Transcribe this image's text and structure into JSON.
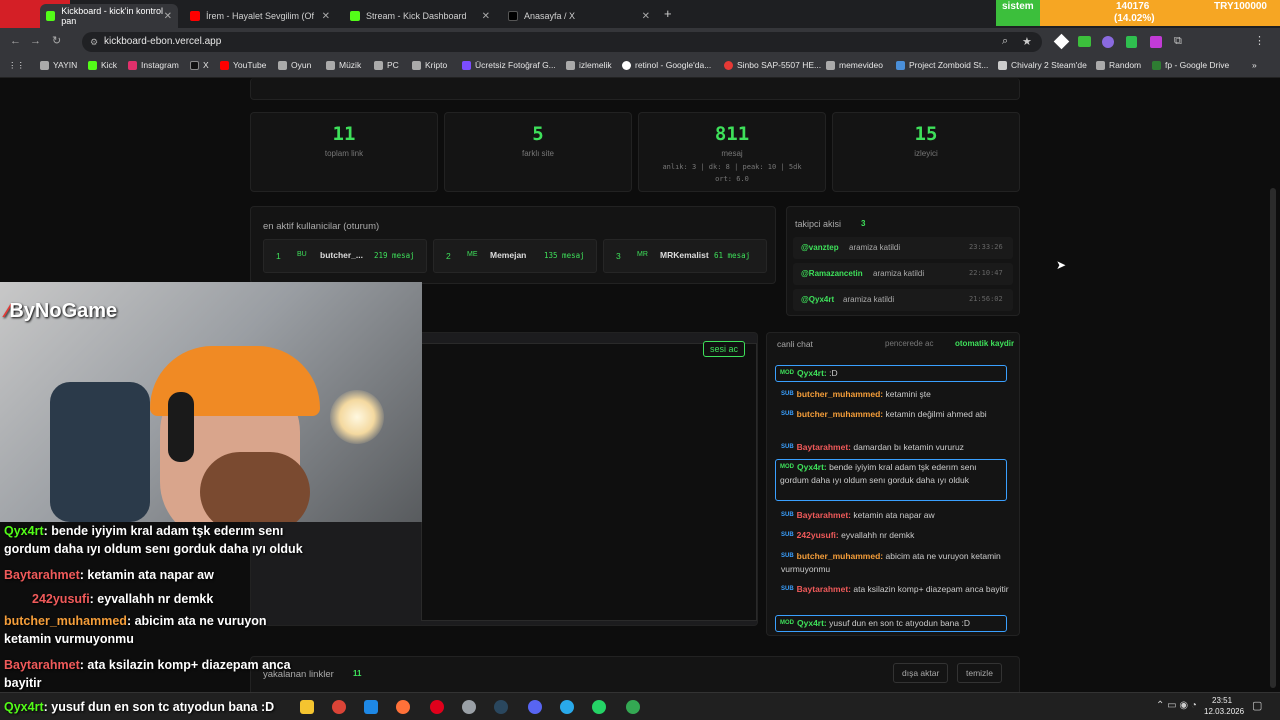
{
  "browser": {
    "tabs": [
      {
        "title": "Kickboard - kick'in kontrol pan"
      },
      {
        "title": "İrem - Hayalet Sevgilim (Of"
      },
      {
        "title": "Stream - Kick Dashboard"
      },
      {
        "title": "Anasayfa / X"
      }
    ],
    "url": "kickboard-ebon.vercel.app",
    "bookmarks": [
      "YAYIN",
      "Kick",
      "Instagram",
      "X",
      "YouTube",
      "Oyun",
      "Müzik",
      "PC",
      "Kripto",
      "Ücretsiz Fotoğraf G...",
      "izlemelik",
      "retinol - Google'da...",
      "Sinbo SAP-5507 HE...",
      "memevideo",
      "Project Zomboid St...",
      "Chivalry 2 Steam'de",
      "Random",
      "fp - Google Drive"
    ]
  },
  "ticker": {
    "label": "sistem",
    "value": "140176",
    "change": "(14.02%)",
    "pair": "TRY100000"
  },
  "stats": [
    {
      "value": "11",
      "label": "toplam link"
    },
    {
      "value": "5",
      "label": "farklı site"
    },
    {
      "value": "811",
      "label": "mesaj",
      "extra1": "anlık: 3 | dk: 8 | peak: 10 | 5dk",
      "extra2": "ort: 6.0"
    },
    {
      "value": "15",
      "label": "izleyici"
    }
  ],
  "active_users": {
    "title": "en aktif kullanicilar (oturum)",
    "users": [
      {
        "rank": "1",
        "initials": "BU",
        "name": "butcher_...",
        "count": "219 mesaj"
      },
      {
        "rank": "2",
        "initials": "ME",
        "name": "Memejan",
        "count": "135 mesaj"
      },
      {
        "rank": "3",
        "initials": "MR",
        "name": "MRKemalist",
        "count": "61 mesaj"
      }
    ]
  },
  "follow_stream": {
    "title": "takipci akisi",
    "count": "3",
    "items": [
      {
        "user": "@vanztep",
        "text": "aramiza katildi",
        "time": "23:33:26"
      },
      {
        "user": "@Ramazancetin",
        "text": "aramiza katildi",
        "time": "22:10:47"
      },
      {
        "user": "@Qyx4rt",
        "text": "aramiza katildi",
        "time": "21:56:02"
      }
    ]
  },
  "live_chat": {
    "title": "canli chat",
    "popout": "pencerede ac",
    "autoscroll": "otomatik kaydir",
    "messages": [
      {
        "badge": "MOD",
        "user": "Qyx4rt:",
        "text": ":D",
        "mod": true
      },
      {
        "badge": "SUB",
        "user": "butcher_muhammed:",
        "text": "ketamini şte"
      },
      {
        "badge": "SUB",
        "user": "butcher_muhammed:",
        "text": "ketamin değilmi ahmed abi"
      },
      {
        "badge": "SUB",
        "user": "Baytarahmet:",
        "text": "damardan bı ketamin vururuz"
      },
      {
        "badge": "MOD",
        "user": "Qyx4rt:",
        "text": "bende iyiyim kral adam tşk ederım senı gordum daha ıyı oldum senı gorduk daha ıyı olduk",
        "mod": true
      },
      {
        "badge": "SUB",
        "user": "Baytarahmet:",
        "text": "ketamin ata napar aw"
      },
      {
        "badge": "SUB",
        "user": "242yusufi:",
        "text": "eyvallahh nr demkk"
      },
      {
        "badge": "SUB",
        "user": "butcher_muhammed:",
        "text": "abicim ata ne vuruyon ketamin vurmuyonmu"
      },
      {
        "badge": "SUB",
        "user": "Baytarahmet:",
        "text": "ata ksilazin komp+ diazepam anca bayitir"
      },
      {
        "badge": "MOD",
        "user": "Qyx4rt:",
        "text": "yusuf dun en son tc atıyodun bana :D",
        "mod": true
      }
    ]
  },
  "links": {
    "title": "yakalanan linkler",
    "count": "11",
    "export": "dışa aktar",
    "clear": "temizle"
  },
  "preview": {
    "sound": "sesi ac"
  },
  "overlay": {
    "brand": "ByNoGame",
    "chat": [
      {
        "user": "Qyx4rt",
        "text": ": bende iyiyim kral adam tşk ederım senı gordum daha ıyı oldum senı gorduk daha ıyı olduk"
      },
      {
        "user": "Baytarahmet",
        "text": ": ketamin ata napar aw"
      },
      {
        "user": "242yusufi",
        "text": ": eyvallahh nr demkk"
      },
      {
        "user": "butcher_muhammed",
        "text": ": abicim ata ne vuruyon ketamin vurmuyonmu"
      },
      {
        "user": "Baytarahmet",
        "text": ": ata ksilazin komp+ diazepam anca bayitir"
      },
      {
        "user": "Qyx4rt",
        "text": ": yusuf dun en son tc atıyodun bana :D"
      }
    ]
  },
  "taskbar": {
    "time": "23:51",
    "date": "12.03.2026"
  },
  "colors": {
    "accent": "#3ee05a",
    "mod_border": "#3aa0ff",
    "sub_name": "#f59e3a",
    "bg": "#0d0d0d"
  }
}
